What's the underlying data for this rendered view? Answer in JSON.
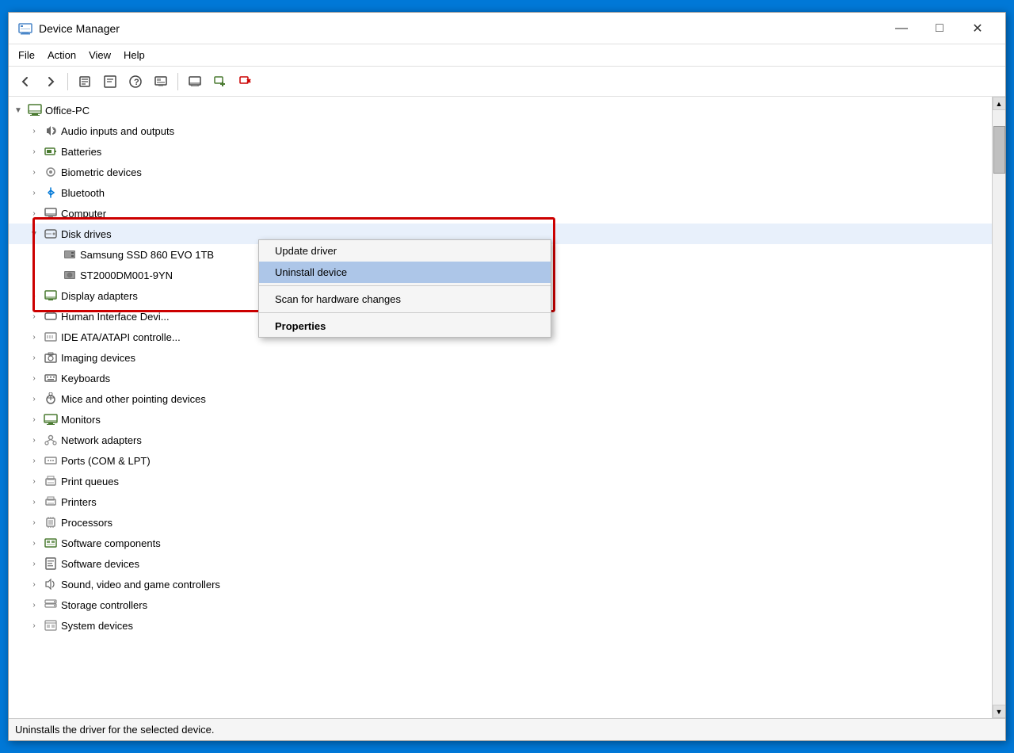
{
  "window": {
    "title": "Device Manager",
    "icon": "device-manager-icon"
  },
  "titlebar": {
    "minimize_label": "—",
    "maximize_label": "□",
    "close_label": "✕"
  },
  "menu": {
    "items": [
      "File",
      "Action",
      "View",
      "Help"
    ]
  },
  "toolbar": {
    "buttons": [
      "←",
      "→",
      "⊞",
      "⊟",
      "?",
      "⊡",
      "🖥",
      "📋",
      "✕"
    ]
  },
  "tree": {
    "root": {
      "label": "Office-PC",
      "expanded": true,
      "children": [
        {
          "id": "audio",
          "label": "Audio inputs and outputs",
          "icon": "audio",
          "expanded": false
        },
        {
          "id": "batteries",
          "label": "Batteries",
          "icon": "battery",
          "expanded": false
        },
        {
          "id": "biometric",
          "label": "Biometric devices",
          "icon": "biometric",
          "expanded": false
        },
        {
          "id": "bluetooth",
          "label": "Bluetooth",
          "icon": "bluetooth",
          "expanded": false
        },
        {
          "id": "computer",
          "label": "Computer",
          "icon": "computer2",
          "expanded": false
        },
        {
          "id": "disk",
          "label": "Disk drives",
          "icon": "disk",
          "expanded": true,
          "children": [
            {
              "id": "samsung",
              "label": "Samsung SSD 860 EVO 1TB",
              "icon": "ssd"
            },
            {
              "id": "st2000",
              "label": "ST2000DM001-9YN",
              "icon": "ssd"
            }
          ]
        },
        {
          "id": "display",
          "label": "Display adapters",
          "icon": "display",
          "expanded": false
        },
        {
          "id": "hid",
          "label": "Human Interface Devi...",
          "icon": "hid",
          "expanded": false
        },
        {
          "id": "ide",
          "label": "IDE ATA/ATAPI controlle...",
          "icon": "ide",
          "expanded": false
        },
        {
          "id": "imaging",
          "label": "Imaging devices",
          "icon": "imaging",
          "expanded": false
        },
        {
          "id": "keyboards",
          "label": "Keyboards",
          "icon": "keyboard",
          "expanded": false
        },
        {
          "id": "mice",
          "label": "Mice and other pointing devices",
          "icon": "mouse",
          "expanded": false
        },
        {
          "id": "monitors",
          "label": "Monitors",
          "icon": "monitor",
          "expanded": false
        },
        {
          "id": "network",
          "label": "Network adapters",
          "icon": "network",
          "expanded": false
        },
        {
          "id": "ports",
          "label": "Ports (COM & LPT)",
          "icon": "port",
          "expanded": false
        },
        {
          "id": "printq",
          "label": "Print queues",
          "icon": "print",
          "expanded": false
        },
        {
          "id": "printers",
          "label": "Printers",
          "icon": "printer",
          "expanded": false
        },
        {
          "id": "processors",
          "label": "Processors",
          "icon": "processor",
          "expanded": false
        },
        {
          "id": "softcomp",
          "label": "Software components",
          "icon": "software",
          "expanded": false
        },
        {
          "id": "softdev",
          "label": "Software devices",
          "icon": "software",
          "expanded": false
        },
        {
          "id": "sound",
          "label": "Sound, video and game controllers",
          "icon": "sound",
          "expanded": false
        },
        {
          "id": "storage",
          "label": "Storage controllers",
          "icon": "storage",
          "expanded": false
        },
        {
          "id": "sysdev",
          "label": "System devices",
          "icon": "system",
          "expanded": false
        }
      ]
    }
  },
  "context_menu": {
    "items": [
      {
        "id": "update",
        "label": "Update driver",
        "highlighted": false,
        "bold": false
      },
      {
        "id": "uninstall",
        "label": "Uninstall device",
        "highlighted": true,
        "bold": false
      },
      {
        "id": "sep1",
        "type": "separator"
      },
      {
        "id": "scan",
        "label": "Scan for hardware changes",
        "highlighted": false,
        "bold": false
      },
      {
        "id": "sep2",
        "type": "separator"
      },
      {
        "id": "properties",
        "label": "Properties",
        "highlighted": false,
        "bold": true
      }
    ]
  },
  "status_bar": {
    "text": "Uninstalls the driver for the selected device."
  },
  "highlight": {
    "color": "#cc0000"
  }
}
